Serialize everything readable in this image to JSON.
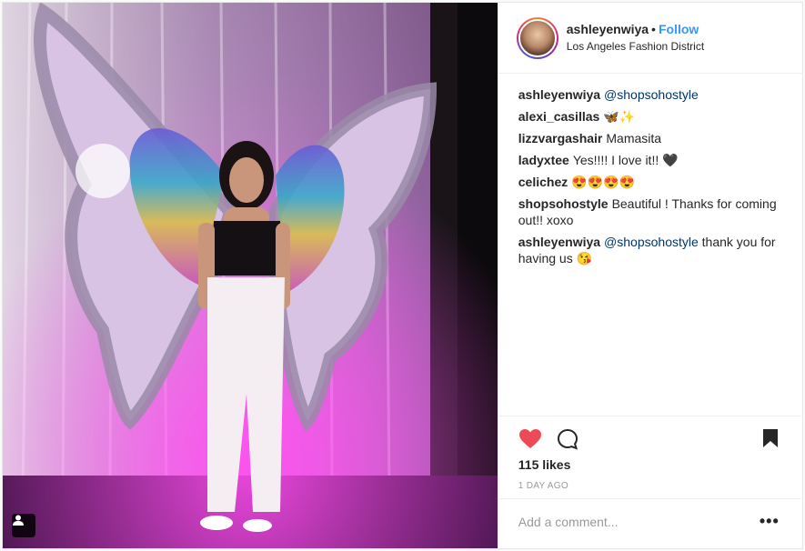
{
  "post": {
    "username": "ashleyenwiya",
    "separator": "•",
    "follow_label": "Follow",
    "location": "Los Angeles Fashion District",
    "accent_color": "#3897f0",
    "like_color": "#ed4956"
  },
  "comments": [
    {
      "user": "ashleyenwiya",
      "mention": "@shopsohostyle",
      "text": ""
    },
    {
      "user": "alexi_casillas",
      "mention": "",
      "text": "🦋✨"
    },
    {
      "user": "lizzvargashair",
      "mention": "",
      "text": "Mamasita"
    },
    {
      "user": "ladyxtee",
      "mention": "",
      "text": "Yes!!!! I love it!! 🖤"
    },
    {
      "user": "celichez",
      "mention": "",
      "text": "😍😍😍😍"
    },
    {
      "user": "shopsohostyle",
      "mention": "",
      "text": "Beautiful ! Thanks for coming out!! xoxo"
    },
    {
      "user": "ashleyenwiya",
      "mention": "@shopsohostyle",
      "text": " thank you for having us 😘"
    }
  ],
  "footer": {
    "likes": "115 likes",
    "time": "1 DAY AGO",
    "comment_placeholder": "Add a comment...",
    "more_label": "•••"
  },
  "icons": {
    "like": "heart-icon",
    "comment": "comment-bubble-icon",
    "save": "bookmark-icon",
    "tagged": "user-tag-icon"
  }
}
